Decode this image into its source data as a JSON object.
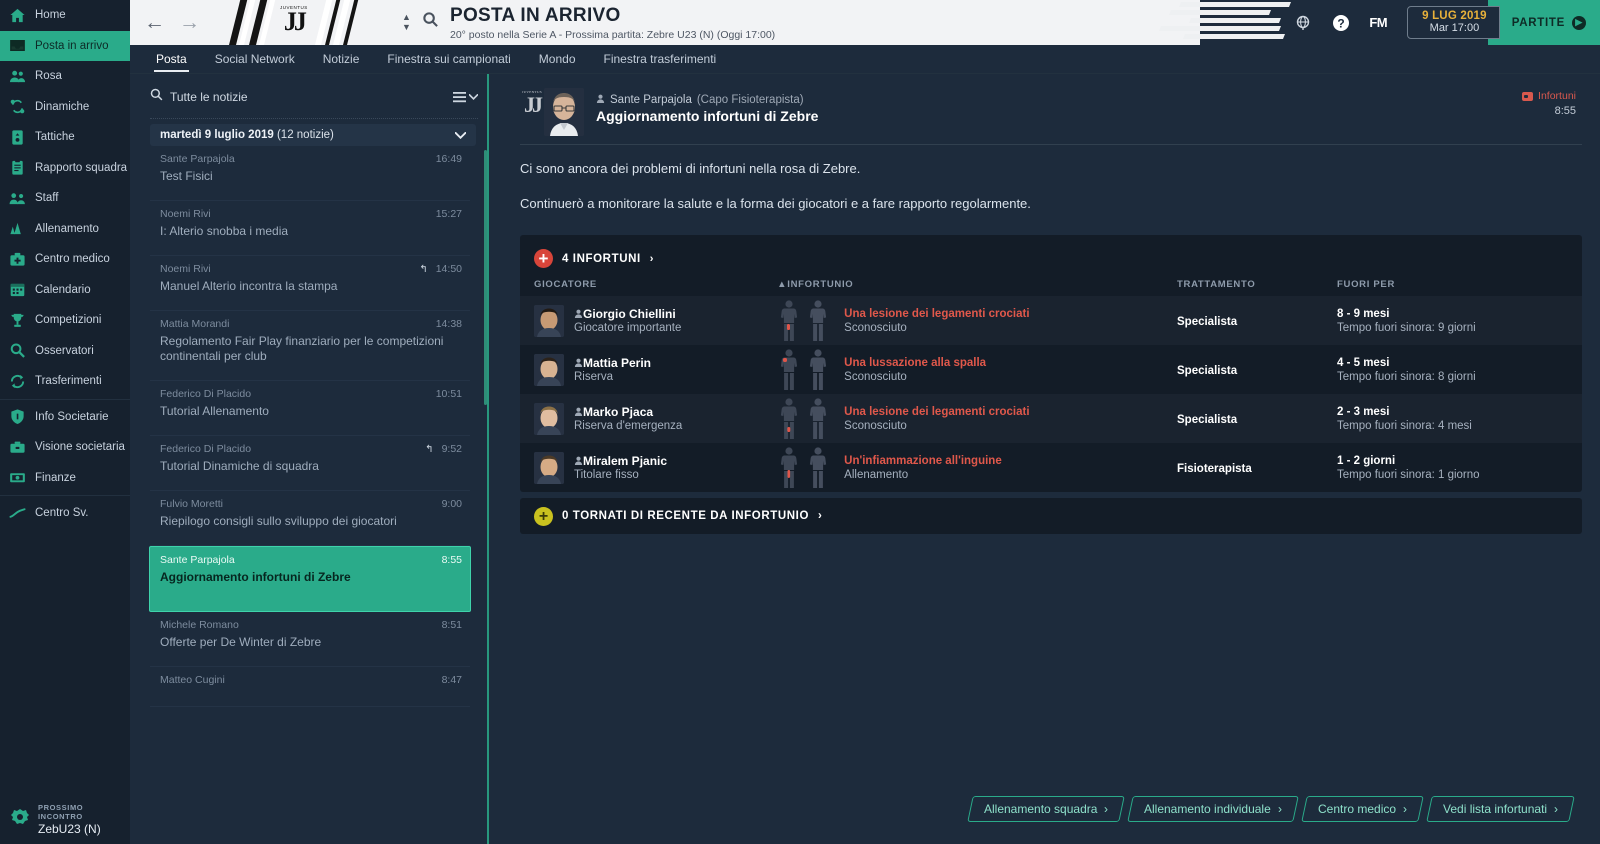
{
  "sidebar": {
    "items": [
      {
        "label": "Home",
        "icon": "home-icon"
      },
      {
        "label": "Posta in arrivo",
        "icon": "inbox-icon",
        "active": true
      },
      {
        "label": "Rosa",
        "icon": "squad-icon"
      },
      {
        "label": "Dinamiche",
        "icon": "dynamics-icon"
      },
      {
        "label": "Tattiche",
        "icon": "tactics-icon"
      },
      {
        "label": "Rapporto squadra",
        "icon": "clipboard-icon"
      },
      {
        "label": "Staff",
        "icon": "staff-icon"
      },
      {
        "label": "Allenamento",
        "icon": "training-icon"
      },
      {
        "label": "Centro medico",
        "icon": "medical-icon"
      },
      {
        "label": "Calendario",
        "icon": "calendar-icon"
      },
      {
        "label": "Competizioni",
        "icon": "trophy-icon"
      },
      {
        "label": "Osservatori",
        "icon": "scout-magnifier-icon"
      },
      {
        "label": "Trasferimenti",
        "icon": "transfers-icon"
      },
      {
        "label": "Info Societarie",
        "icon": "shield-icon"
      },
      {
        "label": "Visione societaria",
        "icon": "briefcase-icon"
      },
      {
        "label": "Finanze",
        "icon": "money-icon"
      },
      {
        "label": "Centro Sv.",
        "icon": "development-chart-icon"
      }
    ],
    "next_match": {
      "caption": "PROSSIMO INCONTRO",
      "opponent": "ZebU23 (N)"
    }
  },
  "header": {
    "title": "POSTA IN ARRIVO",
    "subtitle": "20° posto nella Serie A - Prossima partita: Zebre U23 (N) (Oggi 17:00)",
    "back_icon": "back-arrow-icon",
    "forward_icon": "forward-arrow-icon",
    "search_icon": "search-icon",
    "globe_icon": "globe-icon",
    "help_icon": "help-icon",
    "fm_label": "FM",
    "date_line1": "9 LUG 2019",
    "date_line2": "Mar 17:00",
    "continue_label": "PARTITE"
  },
  "tabs": [
    {
      "label": "Posta",
      "active": true
    },
    {
      "label": "Social Network",
      "active": false
    },
    {
      "label": "Notizie",
      "active": false
    },
    {
      "label": "Finestra sui campionati",
      "active": false
    },
    {
      "label": "Mondo",
      "active": false
    },
    {
      "label": "Finestra trasferimenti",
      "active": false
    }
  ],
  "news": {
    "search_label": "Tutte le notizie",
    "filter_icon": "list-filter-icon",
    "group_label": "martedì 9 luglio 2019",
    "group_count": "(12 notizie)",
    "items": [
      {
        "from": "Sante Parpajola",
        "time": "16:49",
        "subject": "Test Fisici",
        "replied": false,
        "selected": false
      },
      {
        "from": "Noemi Rivi",
        "time": "15:27",
        "subject": "I: Alterio snobba i media",
        "replied": false,
        "selected": false
      },
      {
        "from": "Noemi Rivi",
        "time": "14:50",
        "subject": "Manuel Alterio incontra la stampa",
        "replied": true,
        "selected": false
      },
      {
        "from": "Mattia Morandi",
        "time": "14:38",
        "subject": "Regolamento Fair Play finanziario per le competizioni continentali per club",
        "replied": false,
        "selected": false
      },
      {
        "from": "Federico Di Placido",
        "time": "10:51",
        "subject": "Tutorial Allenamento",
        "replied": false,
        "selected": false
      },
      {
        "from": "Federico Di Placido",
        "time": "9:52",
        "subject": "Tutorial Dinamiche di squadra",
        "replied": true,
        "selected": false
      },
      {
        "from": "Fulvio Moretti",
        "time": "9:00",
        "subject": "Riepilogo consigli sullo sviluppo dei giocatori",
        "replied": false,
        "selected": false
      },
      {
        "from": "Sante Parpajola",
        "time": "8:55",
        "subject": "Aggiornamento infortuni di Zebre",
        "replied": false,
        "selected": true
      },
      {
        "from": "Michele Romano",
        "time": "8:51",
        "subject": "Offerte per De Winter di Zebre",
        "replied": false,
        "selected": false
      },
      {
        "from": "Matteo Cugini",
        "time": "8:47",
        "subject": "",
        "replied": false,
        "selected": false
      }
    ]
  },
  "mail": {
    "sender": "Sante Parpajola",
    "sender_role": "(Capo Fisioterapista)",
    "subject": "Aggiornamento infortuni di Zebre",
    "tag": "Infortuni",
    "time": "8:55",
    "paragraph1": "Ci sono ancora dei problemi di infortuni nella rosa di Zebre.",
    "paragraph2": "Continuerò a monitorare la salute e la forma dei giocatori e a fare rapporto regolarmente."
  },
  "injury_panel": {
    "title": "4 INFORTUNI",
    "chevron": "›",
    "columns": [
      "GIOCATORE",
      "INFORTUNIO",
      "TRATTAMENTO",
      "FUORI PER"
    ],
    "sort_column": "INFORTUNIO",
    "rows": [
      {
        "player": "Giorgio Chiellini",
        "role": "Giocatore importante",
        "injury": "Una lesione dei legamenti crociati",
        "source": "Sconosciuto",
        "treatment": "Specialista",
        "out_for": "8 - 9 mesi",
        "out_so_far": "Tempo fuori sinora: 9 giorni",
        "body_part": "front-thigh"
      },
      {
        "player": "Mattia Perin",
        "role": "Riserva",
        "injury": "Una lussazione alla spalla",
        "source": "Sconosciuto",
        "treatment": "Specialista",
        "out_for": "4 - 5 mesi",
        "out_so_far": "Tempo fuori sinora: 8 giorni",
        "body_part": "front-shoulder"
      },
      {
        "player": "Marko Pjaca",
        "role": "Riserva d'emergenza",
        "injury": "Una lesione dei legamenti crociati",
        "source": "Sconosciuto",
        "treatment": "Specialista",
        "out_for": "2 - 3 mesi",
        "out_so_far": "Tempo fuori sinora: 4 mesi",
        "body_part": "front-knee"
      },
      {
        "player": "Miralem Pjanic",
        "role": "Titolare fisso",
        "injury": "Un'infiammazione all'inguine",
        "source": "Allenamento",
        "treatment": "Fisioterapista",
        "out_for": "1 - 2 giorni",
        "out_so_far": "Tempo fuori sinora: 1 giorno",
        "body_part": "front-groin"
      }
    ]
  },
  "returned_panel": {
    "title": "0 TORNATI DI RECENTE DA INFORTUNIO",
    "chevron": "›"
  },
  "footer_buttons": [
    {
      "label": "Allenamento squadra",
      "chevron": "›"
    },
    {
      "label": "Allenamento individuale",
      "chevron": "›"
    },
    {
      "label": "Centro medico",
      "chevron": "›"
    },
    {
      "label": "Vedi lista infortunati",
      "chevron": "›"
    }
  ],
  "colors": {
    "accent": "#2aab8a",
    "background": "#1d2b3c",
    "panel": "#131c27",
    "injury_red": "#e0584b",
    "date_yellow": "#e8b13a"
  }
}
